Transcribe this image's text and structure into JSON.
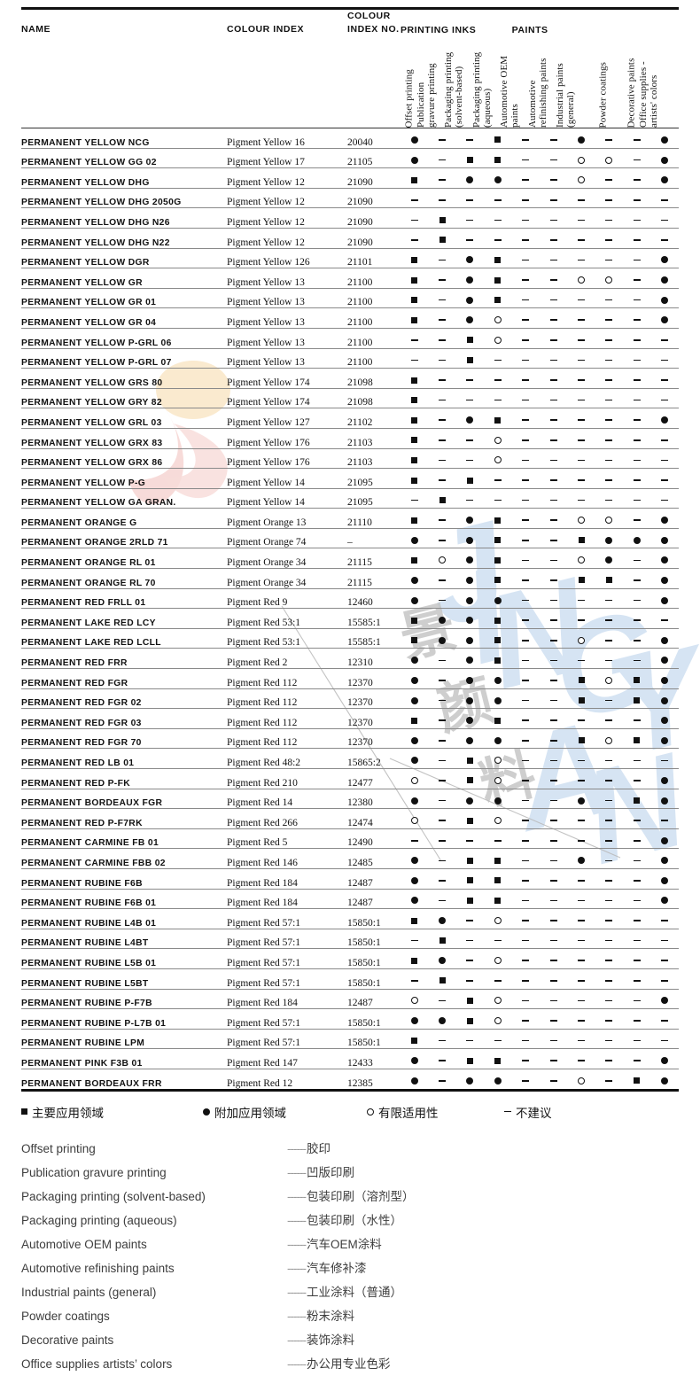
{
  "table": {
    "headers": {
      "name": "NAME",
      "colour_index": "COLOUR INDEX",
      "colour_index_no": "COLOUR INDEX NO.",
      "group_printing_inks": "PRINTING INKS",
      "group_paints": "PAINTS"
    },
    "columns": [
      {
        "id": "offset",
        "label_lines": [
          "Offset printing"
        ]
      },
      {
        "id": "gravure",
        "label_lines": [
          "Publication",
          "gravure printing"
        ]
      },
      {
        "id": "pack_solvent",
        "label_lines": [
          "Packaging printing",
          "(solvent-based)"
        ]
      },
      {
        "id": "pack_aqueous",
        "label_lines": [
          "Packaging printing",
          "(aqueous)"
        ]
      },
      {
        "id": "auto_oem",
        "label_lines": [
          "Automotive OEM",
          "paints"
        ]
      },
      {
        "id": "auto_refinish",
        "label_lines": [
          "Automotive",
          "refinishing paints"
        ]
      },
      {
        "id": "industrial",
        "label_lines": [
          "Industrial paints",
          "(general)"
        ]
      },
      {
        "id": "powder",
        "label_lines": [
          "Powder coatings"
        ]
      },
      {
        "id": "decorative",
        "label_lines": [
          "Decorative paints"
        ]
      },
      {
        "id": "office",
        "label_lines": [
          "Office supplies -",
          "artists' colors"
        ]
      }
    ],
    "rows": [
      {
        "name": "PERMANENT YELLOW NCG",
        "ci": "Pigment Yellow 16",
        "cino": "20040",
        "marks": [
          "c",
          "d",
          "d",
          "s",
          "d",
          "d",
          "c",
          "d",
          "d",
          "c"
        ]
      },
      {
        "name": "PERMANENT YELLOW GG 02",
        "ci": "Pigment Yellow 17",
        "cino": "21105",
        "marks": [
          "c",
          "d",
          "s",
          "s",
          "d",
          "d",
          "o",
          "o",
          "d",
          "c"
        ]
      },
      {
        "name": "PERMANENT YELLOW DHG",
        "ci": "Pigment Yellow 12",
        "cino": "21090",
        "marks": [
          "s",
          "d",
          "c",
          "c",
          "d",
          "d",
          "o",
          "d",
          "d",
          "c"
        ]
      },
      {
        "name": "PERMANENT YELLOW DHG 2050G",
        "ci": "Pigment Yellow 12",
        "cino": "21090",
        "marks": [
          "d",
          "d",
          "d",
          "d",
          "d",
          "d",
          "d",
          "d",
          "d",
          "d"
        ]
      },
      {
        "name": "PERMANENT YELLOW DHG N26",
        "ci": "Pigment Yellow 12",
        "cino": "21090",
        "marks": [
          "d",
          "s",
          "d",
          "d",
          "d",
          "d",
          "d",
          "d",
          "d",
          "d"
        ]
      },
      {
        "name": "PERMANENT YELLOW DHG N22",
        "ci": "Pigment Yellow 12",
        "cino": "21090",
        "marks": [
          "d",
          "s",
          "d",
          "d",
          "d",
          "d",
          "d",
          "d",
          "d",
          "d"
        ]
      },
      {
        "name": "PERMANENT YELLOW DGR",
        "ci": "Pigment Yellow 126",
        "cino": "21101",
        "marks": [
          "s",
          "d",
          "c",
          "s",
          "d",
          "d",
          "d",
          "d",
          "d",
          "c"
        ]
      },
      {
        "name": "PERMANENT YELLOW GR",
        "ci": "Pigment Yellow 13",
        "cino": "21100",
        "marks": [
          "s",
          "d",
          "c",
          "s",
          "d",
          "d",
          "o",
          "o",
          "d",
          "c"
        ]
      },
      {
        "name": "PERMANENT YELLOW GR 01",
        "ci": "Pigment Yellow 13",
        "cino": "21100",
        "marks": [
          "s",
          "d",
          "c",
          "s",
          "d",
          "d",
          "d",
          "d",
          "d",
          "c"
        ]
      },
      {
        "name": "PERMANENT YELLOW GR 04",
        "ci": "Pigment Yellow 13",
        "cino": "21100",
        "marks": [
          "s",
          "d",
          "c",
          "o",
          "d",
          "d",
          "d",
          "d",
          "d",
          "c"
        ]
      },
      {
        "name": "PERMANENT YELLOW P-GRL 06",
        "ci": "Pigment Yellow 13",
        "cino": "21100",
        "marks": [
          "d",
          "d",
          "s",
          "o",
          "d",
          "d",
          "d",
          "d",
          "d",
          "d"
        ]
      },
      {
        "name": "PERMANENT YELLOW P-GRL 07",
        "ci": "Pigment Yellow 13",
        "cino": "21100",
        "marks": [
          "d",
          "d",
          "s",
          "d",
          "d",
          "d",
          "d",
          "d",
          "d",
          "d"
        ]
      },
      {
        "name": "PERMANENT YELLOW GRS 80",
        "ci": "Pigment Yellow 174",
        "cino": "21098",
        "marks": [
          "s",
          "d",
          "d",
          "d",
          "d",
          "d",
          "d",
          "d",
          "d",
          "d"
        ]
      },
      {
        "name": "PERMANENT YELLOW GRY 82",
        "ci": "Pigment Yellow 174",
        "cino": "21098",
        "marks": [
          "s",
          "d",
          "d",
          "d",
          "d",
          "d",
          "d",
          "d",
          "d",
          "d"
        ]
      },
      {
        "name": "PERMANENT YELLOW GRL 03",
        "ci": "Pigment Yellow 127",
        "cino": "21102",
        "marks": [
          "s",
          "d",
          "c",
          "s",
          "d",
          "d",
          "d",
          "d",
          "d",
          "c"
        ]
      },
      {
        "name": "PERMANENT YELLOW GRX 83",
        "ci": "Pigment Yellow 176",
        "cino": "21103",
        "marks": [
          "s",
          "d",
          "d",
          "o",
          "d",
          "d",
          "d",
          "d",
          "d",
          "d"
        ]
      },
      {
        "name": "PERMANENT YELLOW GRX 86",
        "ci": "Pigment Yellow 176",
        "cino": "21103",
        "marks": [
          "s",
          "d",
          "d",
          "o",
          "d",
          "d",
          "d",
          "d",
          "d",
          "d"
        ]
      },
      {
        "name": "PERMANENT YELLOW P-G",
        "ci": "Pigment Yellow 14",
        "cino": "21095",
        "marks": [
          "s",
          "d",
          "s",
          "d",
          "d",
          "d",
          "d",
          "d",
          "d",
          "d"
        ]
      },
      {
        "name": "PERMANENT YELLOW GA GRAN.",
        "ci": "Pigment Yellow 14",
        "cino": "21095",
        "marks": [
          "d",
          "s",
          "d",
          "d",
          "d",
          "d",
          "d",
          "d",
          "d",
          "d"
        ]
      },
      {
        "name": "PERMANENT ORANGE G",
        "ci": "Pigment Orange 13",
        "cino": "21110",
        "marks": [
          "s",
          "d",
          "c",
          "s",
          "d",
          "d",
          "o",
          "o",
          "d",
          "c"
        ]
      },
      {
        "name": "PERMANENT ORANGE 2RLD 71",
        "ci": "Pigment Orange 74",
        "cino": "–",
        "marks": [
          "c",
          "d",
          "c",
          "s",
          "d",
          "d",
          "s",
          "c",
          "c",
          "c"
        ]
      },
      {
        "name": "PERMANENT ORANGE RL 01",
        "ci": "Pigment Orange 34",
        "cino": "21115",
        "marks": [
          "s",
          "o",
          "c",
          "s",
          "d",
          "d",
          "o",
          "c",
          "d",
          "c"
        ]
      },
      {
        "name": "PERMANENT ORANGE RL 70",
        "ci": "Pigment Orange 34",
        "cino": "21115",
        "marks": [
          "c",
          "d",
          "c",
          "s",
          "d",
          "d",
          "s",
          "s",
          "d",
          "c"
        ]
      },
      {
        "name": "PERMANENT RED FRLL 01",
        "ci": "Pigment Red 9",
        "cino": "12460",
        "marks": [
          "c",
          "d",
          "c",
          "c",
          "d",
          "d",
          "d",
          "d",
          "d",
          "c"
        ]
      },
      {
        "name": "PERMANENT LAKE RED LCY",
        "ci": "Pigment Red 53:1",
        "cino": "15585:1",
        "marks": [
          "s",
          "c",
          "c",
          "s",
          "d",
          "d",
          "d",
          "d",
          "d",
          "d"
        ]
      },
      {
        "name": "PERMANENT LAKE RED LCLL",
        "ci": "Pigment Red 53:1",
        "cino": "15585:1",
        "marks": [
          "s",
          "c",
          "c",
          "s",
          "d",
          "d",
          "o",
          "d",
          "d",
          "c"
        ]
      },
      {
        "name": "PERMANENT RED FRR",
        "ci": "Pigment Red 2",
        "cino": "12310",
        "marks": [
          "c",
          "d",
          "c",
          "s",
          "d",
          "d",
          "d",
          "d",
          "d",
          "c"
        ]
      },
      {
        "name": "PERMANENT RED FGR",
        "ci": "Pigment Red 112",
        "cino": "12370",
        "marks": [
          "c",
          "d",
          "c",
          "c",
          "d",
          "d",
          "s",
          "o",
          "s",
          "c"
        ]
      },
      {
        "name": "PERMANENT RED FGR 02",
        "ci": "Pigment Red 112",
        "cino": "12370",
        "marks": [
          "c",
          "d",
          "c",
          "c",
          "d",
          "d",
          "s",
          "d",
          "s",
          "c"
        ]
      },
      {
        "name": "PERMANENT RED FGR 03",
        "ci": "Pigment Red 112",
        "cino": "12370",
        "marks": [
          "s",
          "d",
          "c",
          "s",
          "d",
          "d",
          "d",
          "d",
          "d",
          "c"
        ]
      },
      {
        "name": "PERMANENT RED FGR 70",
        "ci": "Pigment Red 112",
        "cino": "12370",
        "marks": [
          "c",
          "d",
          "c",
          "c",
          "d",
          "d",
          "s",
          "o",
          "s",
          "c"
        ]
      },
      {
        "name": "PERMANENT RED LB 01",
        "ci": "Pigment Red 48:2",
        "cino": "15865:2",
        "marks": [
          "c",
          "d",
          "s",
          "o",
          "d",
          "d",
          "d",
          "d",
          "d",
          "d"
        ]
      },
      {
        "name": "PERMANENT RED P-FK",
        "ci": "Pigment Red 210",
        "cino": "12477",
        "marks": [
          "o",
          "d",
          "s",
          "o",
          "d",
          "d",
          "d",
          "d",
          "d",
          "c"
        ]
      },
      {
        "name": "PERMANENT BORDEAUX FGR",
        "ci": "Pigment Red 14",
        "cino": "12380",
        "marks": [
          "c",
          "d",
          "c",
          "c",
          "d",
          "d",
          "c",
          "d",
          "s",
          "c"
        ]
      },
      {
        "name": "PERMANENT RED P-F7RK",
        "ci": "Pigment Red 266",
        "cino": "12474",
        "marks": [
          "o",
          "d",
          "s",
          "o",
          "d",
          "d",
          "d",
          "d",
          "d",
          "d"
        ]
      },
      {
        "name": "PERMANENT CARMINE FB 01",
        "ci": "Pigment Red 5",
        "cino": "12490",
        "marks": [
          "d",
          "d",
          "d",
          "d",
          "d",
          "d",
          "d",
          "d",
          "d",
          "c"
        ]
      },
      {
        "name": "PERMANENT CARMINE FBB 02",
        "ci": "Pigment Red 146",
        "cino": "12485",
        "marks": [
          "c",
          "d",
          "s",
          "s",
          "d",
          "d",
          "c",
          "d",
          "d",
          "c"
        ]
      },
      {
        "name": "PERMANENT RUBINE F6B",
        "ci": "Pigment Red 184",
        "cino": "12487",
        "marks": [
          "c",
          "d",
          "s",
          "s",
          "d",
          "d",
          "d",
          "d",
          "d",
          "c"
        ]
      },
      {
        "name": "PERMANENT RUBINE F6B 01",
        "ci": "Pigment Red 184",
        "cino": "12487",
        "marks": [
          "c",
          "d",
          "s",
          "s",
          "d",
          "d",
          "d",
          "d",
          "d",
          "c"
        ]
      },
      {
        "name": "PERMANENT RUBINE L4B 01",
        "ci": "Pigment Red 57:1",
        "cino": "15850:1",
        "marks": [
          "s",
          "c",
          "d",
          "o",
          "d",
          "d",
          "d",
          "d",
          "d",
          "d"
        ]
      },
      {
        "name": "PERMANENT RUBINE L4BT",
        "ci": "Pigment Red 57:1",
        "cino": "15850:1",
        "marks": [
          "d",
          "s",
          "d",
          "d",
          "d",
          "d",
          "d",
          "d",
          "d",
          "d"
        ]
      },
      {
        "name": "PERMANENT RUBINE L5B 01",
        "ci": "Pigment Red 57:1",
        "cino": "15850:1",
        "marks": [
          "s",
          "c",
          "d",
          "o",
          "d",
          "d",
          "d",
          "d",
          "d",
          "d"
        ]
      },
      {
        "name": "PERMANENT RUBINE L5BT",
        "ci": "Pigment Red 57:1",
        "cino": "15850:1",
        "marks": [
          "d",
          "s",
          "d",
          "d",
          "d",
          "d",
          "d",
          "d",
          "d",
          "d"
        ]
      },
      {
        "name": "PERMANENT RUBINE P-F7B",
        "ci": "Pigment Red 184",
        "cino": "12487",
        "marks": [
          "o",
          "d",
          "s",
          "o",
          "d",
          "d",
          "d",
          "d",
          "d",
          "c"
        ]
      },
      {
        "name": "PERMANENT RUBINE P-L7B 01",
        "ci": "Pigment Red 57:1",
        "cino": "15850:1",
        "marks": [
          "c",
          "c",
          "s",
          "o",
          "d",
          "d",
          "d",
          "d",
          "d",
          "d"
        ]
      },
      {
        "name": "PERMANENT RUBINE LPM",
        "ci": "Pigment Red 57:1",
        "cino": "15850:1",
        "marks": [
          "s",
          "d",
          "d",
          "d",
          "d",
          "d",
          "d",
          "d",
          "d",
          "d"
        ]
      },
      {
        "name": "PERMANENT PINK F3B 01",
        "ci": "Pigment Red 147",
        "cino": "12433",
        "marks": [
          "c",
          "d",
          "s",
          "s",
          "d",
          "d",
          "d",
          "d",
          "d",
          "c"
        ]
      },
      {
        "name": "PERMANENT BORDEAUX FRR",
        "ci": "Pigment Red 12",
        "cino": "12385",
        "marks": [
          "c",
          "d",
          "c",
          "c",
          "d",
          "d",
          "o",
          "d",
          "s",
          "c"
        ]
      }
    ]
  },
  "legend": {
    "keys": [
      {
        "symbol": "s",
        "label": "主要应用领域"
      },
      {
        "symbol": "c",
        "label": "附加应用领域"
      },
      {
        "symbol": "o",
        "label": "有限适用性"
      },
      {
        "symbol": "d",
        "label": "不建议"
      }
    ],
    "rows": [
      {
        "en": "Offset printing",
        "dash": "------",
        "zh": "胶印"
      },
      {
        "en": "Publication  gravure printing",
        "dash": "------",
        "zh": "凹版印刷"
      },
      {
        "en": "Packaging printing (solvent-based)",
        "dash": "------",
        "zh": "包装印刷（溶剂型）"
      },
      {
        "en": "Packaging printing (aqueous)",
        "dash": "------",
        "zh": "包装印刷（水性）"
      },
      {
        "en": "Automotive OEM paints",
        "dash": "------",
        "zh": "汽车OEM涂料"
      },
      {
        "en": "Automotive  refinishing paints",
        "dash": "------",
        "zh": "汽车修补漆"
      },
      {
        "en": "Industrial paints (general)",
        "dash": "------",
        "zh": "工业涂料（普通）"
      },
      {
        "en": "Powder coatings",
        "dash": "------",
        "zh": "粉末涂料"
      },
      {
        "en": "Decorative paints",
        "dash": "------",
        "zh": "装饰涂料"
      },
      {
        "en": "Office supplies artists&#8217;   colors",
        "dash": "------",
        "zh": "办公用专业色彩"
      }
    ]
  },
  "colors": {
    "rule": "#111111",
    "row_line": "#8a8a8a",
    "text": "#1a1a1a",
    "legend_text": "#3d3d3d",
    "watermark_blue": "#cfe0f2",
    "watermark_peach": "#f7d9a8",
    "watermark_pink": "#f2bfbb",
    "watermark_gray": "#c8c8c8"
  }
}
